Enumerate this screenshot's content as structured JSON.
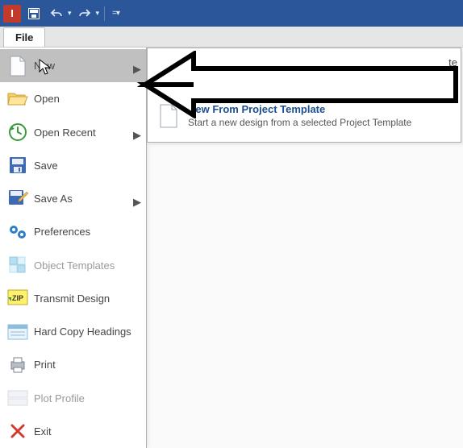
{
  "titlebar": {
    "app_letter": "I"
  },
  "tabs": {
    "file": "File"
  },
  "menu": {
    "new": "New",
    "open": "Open",
    "open_recent": "Open Recent",
    "save": "Save",
    "save_as": "Save As",
    "preferences": "Preferences",
    "object_templates": "Object Templates",
    "transmit_design": "Transmit Design",
    "hard_copy_headings": "Hard Copy Headings",
    "print": "Print",
    "plot_profile": "Plot Profile",
    "exit": "Exit"
  },
  "submenu": {
    "truncated_suffix": "te",
    "item2": {
      "title": "New From Project Template",
      "desc": "Start a new design from a selected Project Template"
    }
  }
}
